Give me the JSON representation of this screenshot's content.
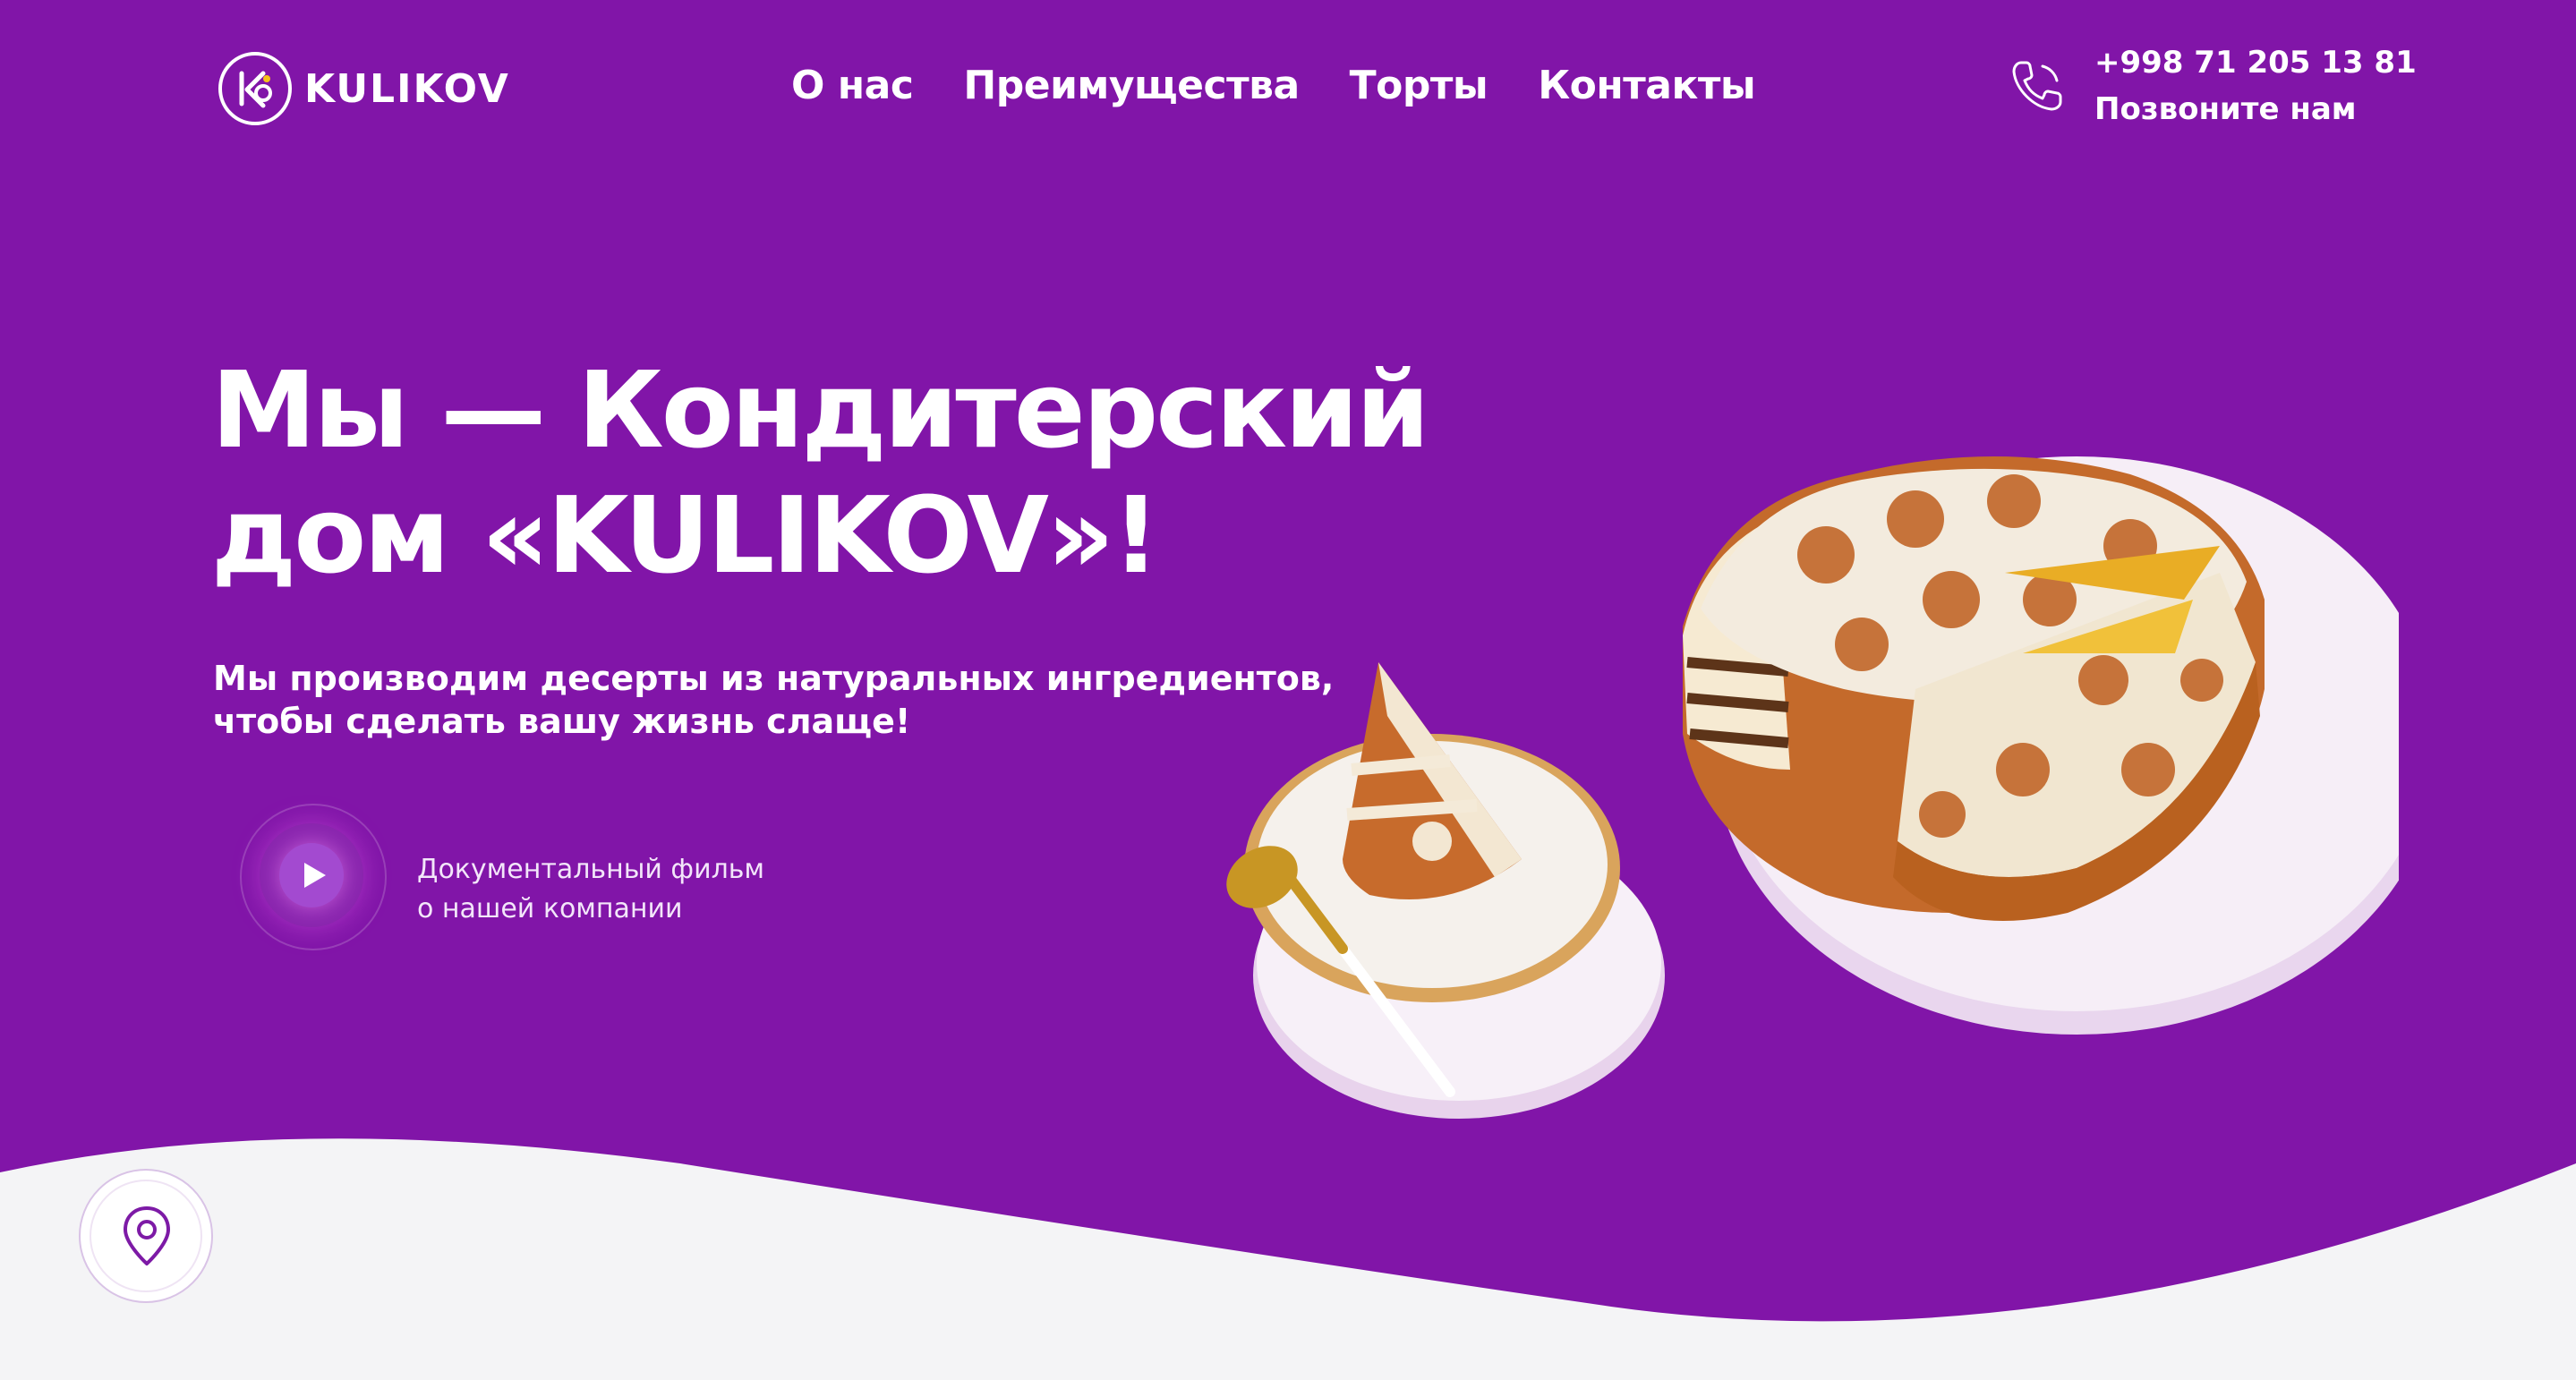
{
  "header": {
    "logo_text": "KULIKOV",
    "nav": [
      {
        "label": "О нас"
      },
      {
        "label": "Преимущества"
      },
      {
        "label": "Торты"
      },
      {
        "label": "Контакты"
      }
    ],
    "phone_number": "+998 71 205 13 81",
    "phone_cta": "Позвоните нам"
  },
  "hero": {
    "title_line1": "Мы — Кондитерский",
    "title_line2": "дом «KULIKOV»!",
    "subtitle_line1": "Мы производим десерты из натуральных ингредиентов,",
    "subtitle_line2": "чтобы сделать вашу жизнь слаще!",
    "video_label_line1": "Документальный фильм",
    "video_label_line2": "о нашей компании"
  },
  "icons": {
    "logo": "kulikov-logo-icon",
    "phone": "phone-icon",
    "play": "play-icon",
    "location": "location-pin-icon"
  },
  "colors": {
    "background": "#8115a8",
    "wave": "#f4f4f6",
    "text": "#ffffff",
    "accent": "#7d1aa6"
  }
}
